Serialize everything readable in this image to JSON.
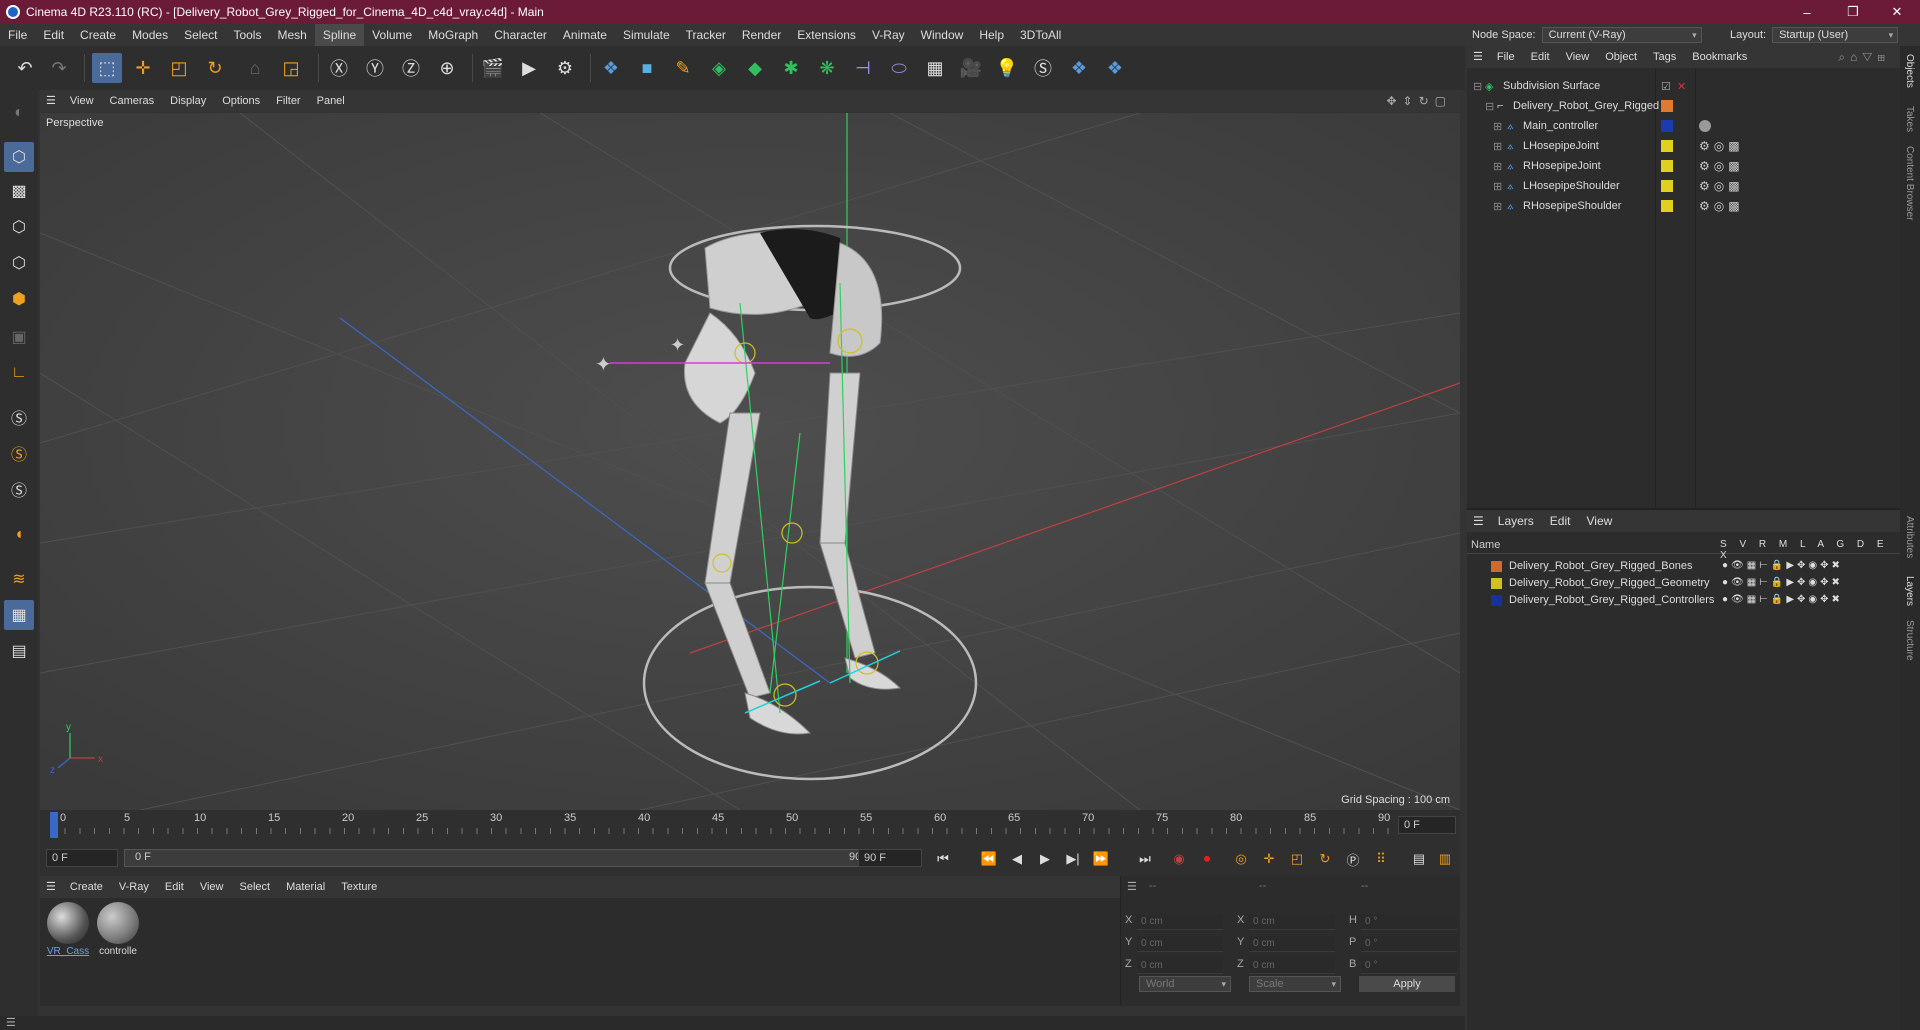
{
  "window": {
    "title": "Cinema 4D R23.110 (RC) - [Delivery_Robot_Grey_Rigged_for_Cinema_4D_c4d_vray.c4d] - Main",
    "controls": [
      "–",
      "❐",
      "✕"
    ]
  },
  "menubar": {
    "items": [
      "File",
      "Edit",
      "Create",
      "Modes",
      "Select",
      "Tools",
      "Mesh",
      "Spline",
      "Volume",
      "MoGraph",
      "Character",
      "Animate",
      "Simulate",
      "Tracker",
      "Render",
      "Extensions",
      "V-Ray",
      "Window",
      "Help",
      "3DToAll"
    ],
    "active": "Spline"
  },
  "header": {
    "node_space_label": "Node Space:",
    "node_space_value": "Current (V-Ray)",
    "layout_label": "Layout:",
    "layout_value": "Startup (User)"
  },
  "viewport": {
    "menu": [
      "View",
      "Cameras",
      "Display",
      "Options",
      "Filter",
      "Panel"
    ],
    "camera_label": "Perspective",
    "grid_spacing": "Grid Spacing : 100 cm"
  },
  "timeline": {
    "ticks": [
      "0",
      "5",
      "10",
      "15",
      "20",
      "25",
      "30",
      "35",
      "40",
      "45",
      "50",
      "55",
      "60",
      "65",
      "70",
      "75",
      "80",
      "85",
      "90"
    ],
    "end_field": "0 F",
    "start_field": "0 F",
    "range_start": "0 F",
    "range_end": "90 F",
    "max_field": "90 F"
  },
  "material_manager": {
    "menu": [
      "Create",
      "V-Ray",
      "Edit",
      "View",
      "Select",
      "Material",
      "Texture"
    ],
    "materials": [
      {
        "name": "VR_Cass"
      },
      {
        "name": "controlle"
      }
    ]
  },
  "coordinates": {
    "header": [
      "--",
      "--",
      "--"
    ],
    "rows": [
      {
        "l1": "X",
        "v1": "0 cm",
        "l2": "X",
        "v2": "0 cm",
        "l3": "H",
        "v3": "0 °"
      },
      {
        "l1": "Y",
        "v1": "0 cm",
        "l2": "Y",
        "v2": "0 cm",
        "l3": "P",
        "v3": "0 °"
      },
      {
        "l1": "Z",
        "v1": "0 cm",
        "l2": "Z",
        "v2": "0 cm",
        "l3": "B",
        "v3": "0 °"
      }
    ],
    "mode": "World",
    "scale": "Scale",
    "apply": "Apply"
  },
  "object_manager": {
    "menu": [
      "File",
      "Edit",
      "View",
      "Object",
      "Tags",
      "Bookmarks"
    ],
    "objects": [
      {
        "name": "Subdivision Surface",
        "color": "#888888"
      },
      {
        "name": "Delivery_Robot_Grey_Rigged",
        "color": "#e07a30"
      },
      {
        "name": "Main_controller",
        "color": "#1a3cb0"
      },
      {
        "name": "LHosepipeJoint",
        "color": "#e0d020"
      },
      {
        "name": "RHosepipeJoint",
        "color": "#e0d020"
      },
      {
        "name": "LHosepipeShoulder",
        "color": "#e0d020"
      },
      {
        "name": "RHosepipeShoulder",
        "color": "#e0d020"
      }
    ]
  },
  "layer_manager": {
    "menu": [
      "Layers",
      "Edit",
      "View"
    ],
    "name_header": "Name",
    "flag_headers": "S V R M L A G D E X",
    "layers": [
      {
        "name": "Delivery_Robot_Grey_Rigged_Bones",
        "color": "#d06a2a"
      },
      {
        "name": "Delivery_Robot_Grey_Rigged_Geometry",
        "color": "#d0c020"
      },
      {
        "name": "Delivery_Robot_Grey_Rigged_Controllers",
        "color": "#1a30a0"
      }
    ]
  },
  "right_tabs": [
    "Objects",
    "Takes",
    "Content Browser",
    "Attributes",
    "Layers",
    "Structure"
  ],
  "icons": {
    "undo": "undo-icon",
    "redo": "redo-icon",
    "select": "live-selection-icon",
    "move": "move-icon",
    "scale": "scale-icon",
    "rotate": "rotate-icon"
  }
}
